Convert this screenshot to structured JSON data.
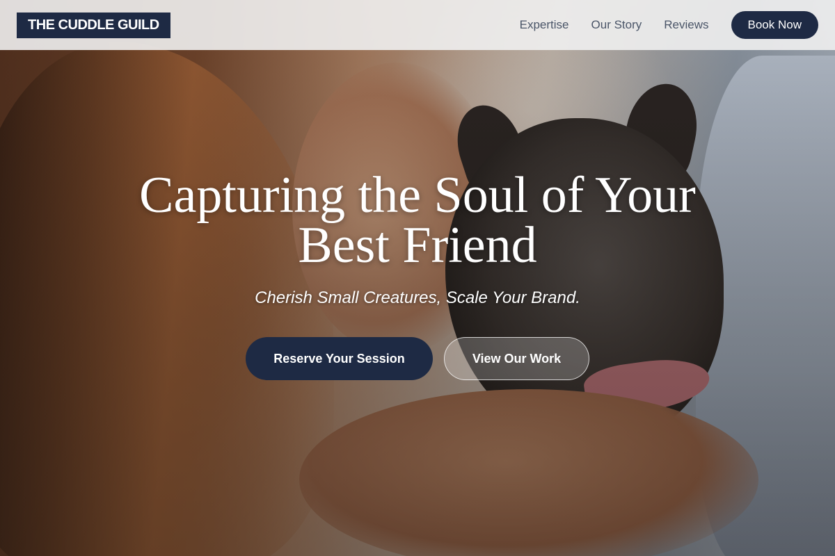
{
  "header": {
    "logo_text": "THE CUDDLE GUILD",
    "nav": [
      {
        "label": "Expertise"
      },
      {
        "label": "Our Story"
      },
      {
        "label": "Reviews"
      }
    ],
    "cta_label": "Book Now"
  },
  "hero": {
    "title": "Capturing the Soul of Your Best Friend",
    "subtitle": "Cherish Small Creatures, Scale Your Brand.",
    "primary_button": "Reserve Your Session",
    "secondary_button": "View Our Work"
  },
  "colors": {
    "brand_navy": "#1e2a44",
    "header_bg": "#f0f0f0",
    "nav_text": "#4a5568"
  }
}
